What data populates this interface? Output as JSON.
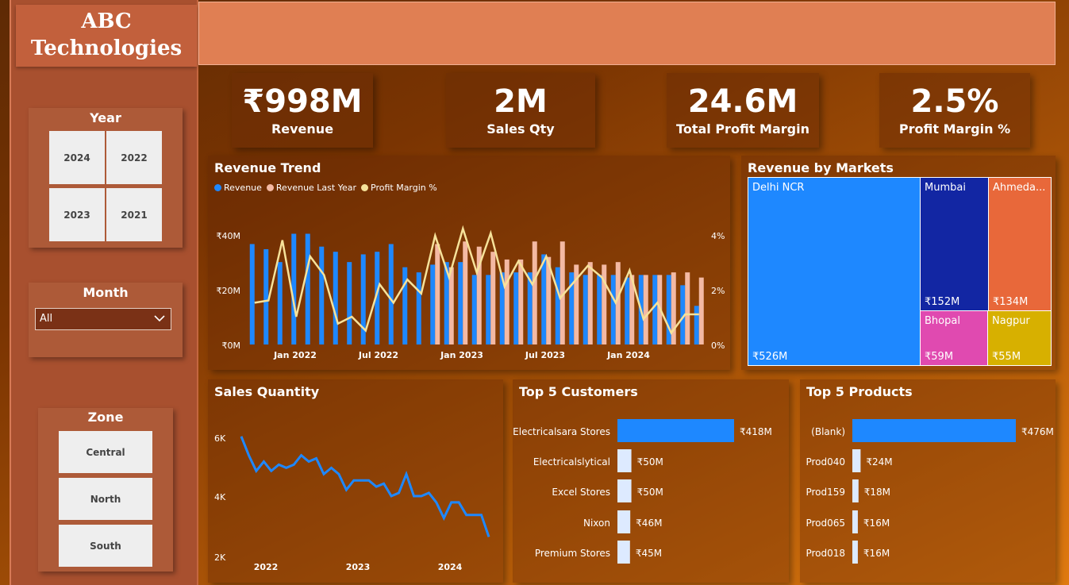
{
  "logo": {
    "line1": "ABC",
    "line2": "Technologies"
  },
  "slicers": {
    "year": {
      "title": "Year",
      "options": [
        "2024",
        "2022",
        "2023",
        "2021"
      ]
    },
    "month": {
      "title": "Month",
      "selected": "All"
    },
    "zone": {
      "title": "Zone",
      "options": [
        "Central",
        "North",
        "South"
      ]
    }
  },
  "kpis": [
    {
      "value": "₹998M",
      "label": "Revenue"
    },
    {
      "value": "2M",
      "label": "Sales Qty"
    },
    {
      "value": "24.6M",
      "label": "Total Profit Margin"
    },
    {
      "value": "2.5%",
      "label": "Profit Margin %"
    }
  ],
  "revenue_trend": {
    "title": "Revenue Trend",
    "legend": [
      "Revenue",
      "Revenue Last Year",
      "Profit Margin %"
    ],
    "y_left_ticks": [
      "₹40M",
      "₹20M",
      "₹0M"
    ],
    "y_right_ticks": [
      "4%",
      "2%",
      "0%"
    ],
    "x_ticks": [
      "Jan 2022",
      "Jul 2022",
      "Jan 2023",
      "Jul 2023",
      "Jan 2024"
    ]
  },
  "revenue_by_markets": {
    "title": "Revenue by Markets",
    "cells": [
      {
        "name": "Delhi NCR",
        "value": "₹526M"
      },
      {
        "name": "Mumbai",
        "value": "₹152M"
      },
      {
        "name": "Ahmeda...",
        "value": "₹134M"
      },
      {
        "name": "Bhopal",
        "value": "₹59M"
      },
      {
        "name": "Nagpur",
        "value": "₹55M"
      }
    ]
  },
  "sales_quantity": {
    "title": "Sales Quantity",
    "y_ticks": [
      "6K",
      "4K",
      "2K"
    ],
    "x_ticks": [
      "2022",
      "2023",
      "2024"
    ]
  },
  "top_customers": {
    "title": "Top 5 Customers",
    "rows": [
      {
        "name": "Electricalsara Stores",
        "value": "₹418M"
      },
      {
        "name": "Electricalslytical",
        "value": "₹50M"
      },
      {
        "name": "Excel Stores",
        "value": "₹50M"
      },
      {
        "name": "Nixon",
        "value": "₹46M"
      },
      {
        "name": "Premium Stores",
        "value": "₹45M"
      }
    ]
  },
  "top_products": {
    "title": "Top 5 Products",
    "rows": [
      {
        "name": "(Blank)",
        "value": "₹476M"
      },
      {
        "name": "Prod040",
        "value": "₹24M"
      },
      {
        "name": "Prod159",
        "value": "₹18M"
      },
      {
        "name": "Prod065",
        "value": "₹16M"
      },
      {
        "name": "Prod018",
        "value": "₹16M"
      }
    ]
  },
  "colors": {
    "revenue": "#1e88ff",
    "revenue_last_year": "#f4b9a3",
    "profit_margin": "#f6e29a",
    "mumbai": "#1226a3",
    "ahmedabad": "#e8683a",
    "bhopal": "#e04ab0",
    "nagpur": "#d7b000"
  },
  "chart_data": [
    {
      "type": "bar",
      "title": "Revenue Trend",
      "x": [
        "2021-10",
        "2021-11",
        "2021-12",
        "2022-01",
        "2022-02",
        "2022-03",
        "2022-04",
        "2022-05",
        "2022-06",
        "2022-07",
        "2022-08",
        "2022-09",
        "2022-10",
        "2022-11",
        "2022-12",
        "2023-01",
        "2023-02",
        "2023-03",
        "2023-04",
        "2023-05",
        "2023-06",
        "2023-07",
        "2023-08",
        "2023-09",
        "2023-10",
        "2023-11",
        "2023-12",
        "2024-01",
        "2024-02",
        "2024-03",
        "2024-04",
        "2024-05",
        "2024-06"
      ],
      "series": [
        {
          "name": "Revenue",
          "values": [
            39,
            37,
            32,
            43,
            43,
            38,
            36,
            32,
            35,
            36,
            39,
            30,
            28,
            31,
            32,
            32,
            27,
            27,
            28,
            28,
            28,
            35,
            30,
            28,
            27,
            27,
            27,
            26,
            27,
            27,
            27,
            23,
            15
          ]
        },
        {
          "name": "Revenue Last Year",
          "values": [
            0,
            0,
            0,
            0,
            0,
            0,
            0,
            0,
            0,
            0,
            0,
            0,
            0,
            39,
            30,
            40,
            38,
            36,
            33,
            33,
            40,
            34,
            40,
            31,
            32,
            31,
            32,
            27,
            27,
            27,
            28,
            28,
            26
          ]
        },
        {
          "name": "Profit Margin %",
          "values": [
            1.8,
            1.9,
            4.5,
            1.2,
            3.8,
            3.0,
            0.9,
            1.2,
            0.6,
            2.6,
            1.8,
            2.8,
            2.2,
            4.7,
            2.9,
            5.0,
            3.1,
            4.8,
            2.5,
            3.6,
            2.6,
            3.8,
            2.0,
            2.7,
            3.4,
            2.9,
            1.8,
            3.2,
            1.1,
            1.8,
            0.5,
            1.3,
            1.3
          ]
        }
      ],
      "y_range": [
        0,
        45
      ],
      "y2_range": [
        0,
        5
      ],
      "y_ticks": [
        "₹0M",
        "₹20M",
        "₹40M"
      ],
      "y2_ticks": [
        "0%",
        "2%",
        "4%"
      ]
    },
    {
      "type": "line",
      "title": "Sales Quantity",
      "series": [
        {
          "values": [
            6100,
            5500,
            5000,
            5300,
            5000,
            5200,
            5100,
            5200,
            5500,
            5300,
            5400,
            4900,
            5100,
            4900,
            4400,
            4700,
            4700,
            4700,
            4500,
            4600,
            4200,
            4300,
            4900,
            4200,
            4200,
            4300,
            4000,
            3500,
            4000,
            4000,
            3600,
            3600,
            3600,
            2900
          ]
        }
      ],
      "y_range": [
        2000,
        6500
      ],
      "x_ticks": [
        "2022",
        "2023",
        "2024"
      ]
    },
    {
      "type": "bar",
      "title": "Top 5 Customers",
      "categories": [
        "Electricalsara Stores",
        "Electricalslytical",
        "Excel Stores",
        "Nixon",
        "Premium Stores"
      ],
      "values": [
        418,
        50,
        50,
        46,
        45
      ]
    },
    {
      "type": "bar",
      "title": "Top 5 Products",
      "categories": [
        "(Blank)",
        "Prod040",
        "Prod159",
        "Prod065",
        "Prod018"
      ],
      "values": [
        476,
        24,
        18,
        16,
        16
      ]
    }
  ]
}
